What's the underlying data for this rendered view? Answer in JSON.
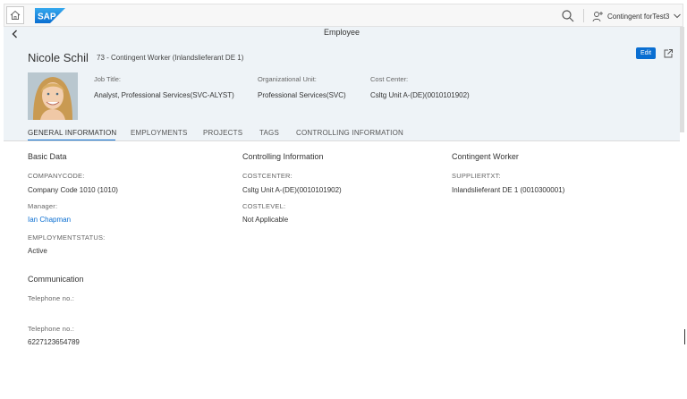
{
  "shell": {
    "home_icon": "home-icon",
    "logo_text": "SAP",
    "search_icon": "search-icon",
    "user_icon": "person-icon",
    "user_name": "Contingent forTest3",
    "dropdown_icon": "chevron-down-icon"
  },
  "subbar": {
    "back_icon": "chevron-left-icon",
    "title": "Employee"
  },
  "header": {
    "name": "Nicole Schil",
    "subtitle": "73 - Contingent Worker (Inlandslieferant DE 1)",
    "edit_label": "Edit",
    "share_icon": "external-link-icon",
    "job_title_label": "Job Title:",
    "job_title_value": "Analyst, Professional Services(SVC-ALYST)",
    "org_unit_label": "Organizational Unit:",
    "org_unit_value": "Professional Services(SVC)",
    "cost_center_label": "Cost Center:",
    "cost_center_value": "Csltg Unit A-(DE)(0010101902)"
  },
  "tabs": [
    {
      "label": "GENERAL INFORMATION",
      "active": true
    },
    {
      "label": "EMPLOYMENTS",
      "active": false
    },
    {
      "label": "PROJECTS",
      "active": false
    },
    {
      "label": "TAGS",
      "active": false
    },
    {
      "label": "CONTROLLING INFORMATION",
      "active": false
    }
  ],
  "basic_data": {
    "title": "Basic Data",
    "company_code_label": "COMPANYCODE:",
    "company_code_value": "Company Code 1010 (1010)",
    "manager_label": "Manager:",
    "manager_value": "Ian Chapman",
    "employment_status_label": "EMPLOYMENTSTATUS:",
    "employment_status_value": "Active"
  },
  "controlling": {
    "title": "Controlling Information",
    "cost_center_label": "COSTCENTER:",
    "cost_center_value": "Csltg Unit A-(DE)(0010101902)",
    "cost_level_label": "COSTLEVEL:",
    "cost_level_value": "Not Applicable"
  },
  "contingent": {
    "title": "Contingent Worker",
    "supplier_label": "SUPPLIERTXT:",
    "supplier_value": "Inlandslieferant DE 1 (0010300001)"
  },
  "communication": {
    "title": "Communication",
    "phone1_label": "Telephone no.:",
    "phone1_value": "",
    "phone2_label": "Telephone no.:",
    "phone2_value": "6227123654789"
  },
  "colors": {
    "accent": "#0a6ed1",
    "header_bg": "#eef3f7",
    "logo_blue": "#1a8fdc"
  }
}
